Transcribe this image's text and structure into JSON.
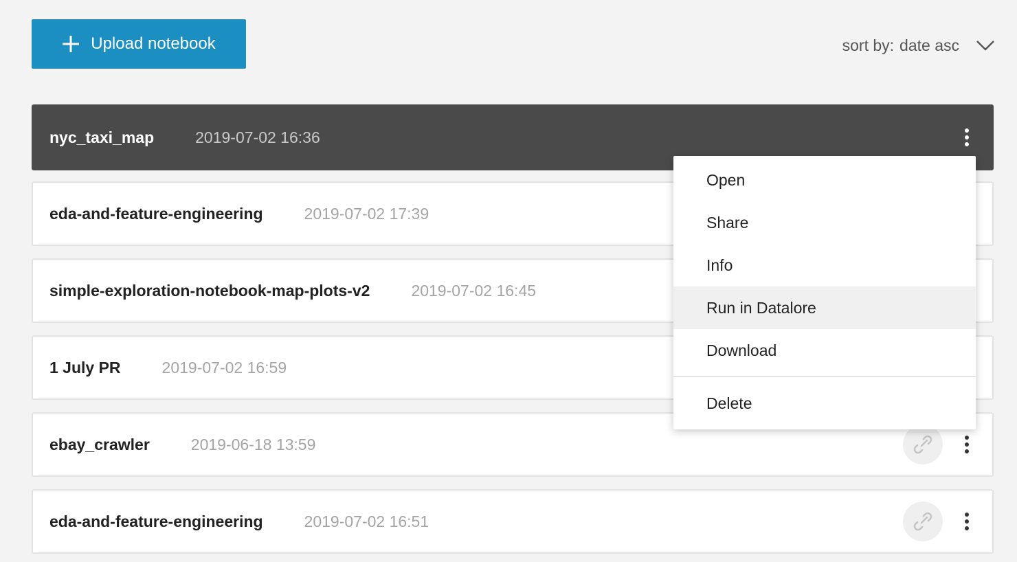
{
  "toolbar": {
    "upload_label": "Upload notebook",
    "sort_label": "sort by:",
    "sort_value": "date asc"
  },
  "notebooks": [
    {
      "name": "nyc_taxi_map",
      "date": "2019-07-02 16:36"
    },
    {
      "name": "eda-and-feature-engineering",
      "date": "2019-07-02 17:39"
    },
    {
      "name": "simple-exploration-notebook-map-plots-v2",
      "date": "2019-07-02 16:45"
    },
    {
      "name": "1 July PR",
      "date": "2019-07-02 16:59"
    },
    {
      "name": "ebay_crawler",
      "date": "2019-06-18 13:59"
    },
    {
      "name": "eda-and-feature-engineering",
      "date": "2019-07-02 16:51"
    }
  ],
  "menu": {
    "items": [
      "Open",
      "Share",
      "Info",
      "Run in Datalore",
      "Download",
      "Delete"
    ]
  },
  "colors": {
    "accent": "#1b8ec2",
    "active_row": "#4a4a4a",
    "background": "#f3f3f3"
  }
}
